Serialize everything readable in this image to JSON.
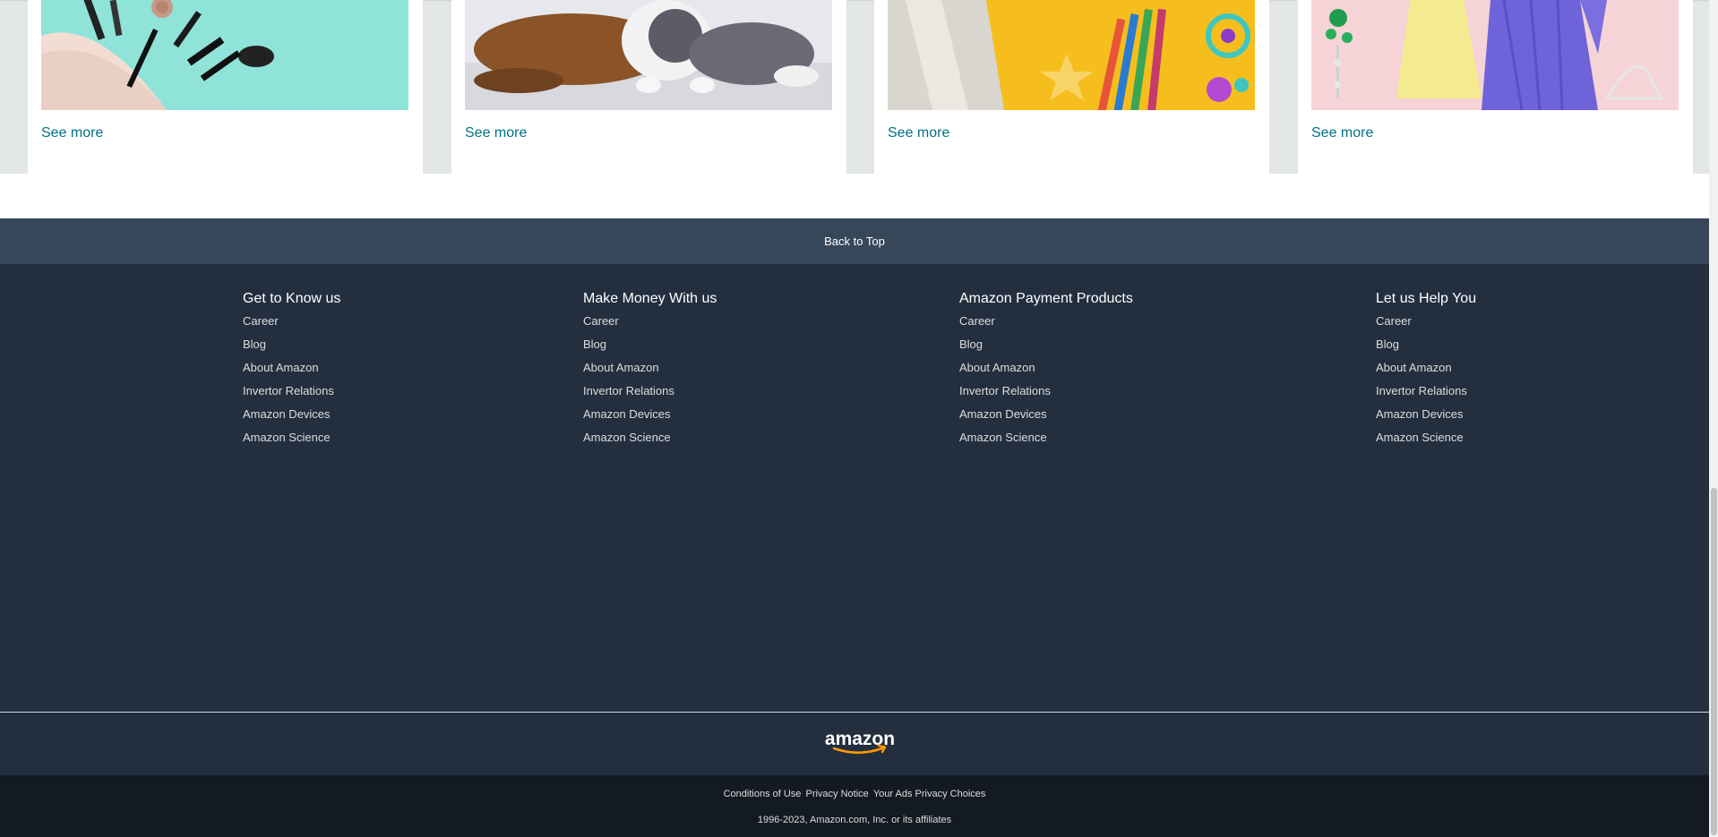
{
  "cards": [
    {
      "image": "makeup-products-image",
      "see_more": "See more"
    },
    {
      "image": "pets-image",
      "see_more": "See more"
    },
    {
      "image": "school-supplies-image",
      "see_more": "See more"
    },
    {
      "image": "fashion-image",
      "see_more": "See more"
    }
  ],
  "back_to_top": "Back to Top",
  "footer": {
    "columns": [
      {
        "heading": "Get to Know us",
        "links": [
          "Career",
          "Blog",
          "About Amazon",
          "Invertor Relations",
          "Amazon Devices",
          "Amazon Science"
        ]
      },
      {
        "heading": "Make Money With us",
        "links": [
          "Career",
          "Blog",
          "About Amazon",
          "Invertor Relations",
          "Amazon Devices",
          "Amazon Science"
        ]
      },
      {
        "heading": "Amazon Payment Products",
        "links": [
          "Career",
          "Blog",
          "About Amazon",
          "Invertor Relations",
          "Amazon Devices",
          "Amazon Science"
        ]
      },
      {
        "heading": "Let us Help You",
        "links": [
          "Career",
          "Blog",
          "About Amazon",
          "Invertor Relations",
          "Amazon Devices",
          "Amazon Science"
        ]
      }
    ],
    "logo_text": "amazon",
    "legal_links": [
      "Conditions of Use",
      "Privacy Notice",
      "Your Ads Privacy Choices"
    ],
    "copyright": "1996-2023, Amazon.com, Inc. or its affiliates"
  },
  "colors": {
    "link": "#007185",
    "back_to_top_bg": "#37475a",
    "footer_bg": "#232f3e",
    "bottom_bg": "#131a22",
    "logo_smile": "#ff9900"
  }
}
